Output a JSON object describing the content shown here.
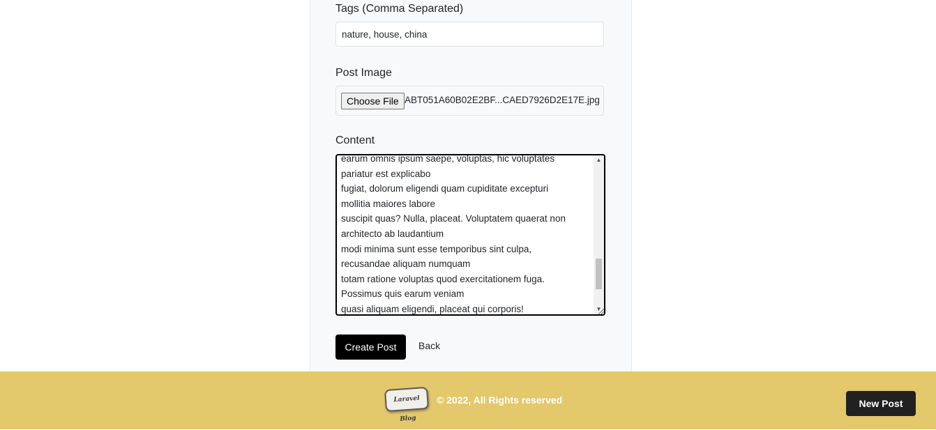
{
  "form": {
    "tags": {
      "label": "Tags (Comma Separated)",
      "value": "nature, house, china"
    },
    "image": {
      "label": "Post Image",
      "button_label": "Choose File",
      "file_name": "ABT051A60B02E2BF...CAED7926D2E17E.jpg"
    },
    "content": {
      "label": "Content",
      "value": "earum omnis ipsum saepe, voluptas, hic voluptates\npariatur est explicabo\nfugiat, dolorum eligendi quam cupiditate excepturi\nmollitia maiores labore\nsuscipit quas? Nulla, placeat. Voluptatem quaerat non\narchitecto ab laudantium\nmodi minima sunt esse temporibus sint culpa,\nrecusandae aliquam numquam\ntotam ratione voluptas quod exercitationem fuga.\nPossimus quis earum veniam\nquasi aliquam eligendi, placeat qui corporis!"
    },
    "submit_label": "Create Post",
    "back_label": "Back"
  },
  "footer": {
    "logo_text": "Laravel Blog",
    "copyright": "© 2022, All Rights reserved",
    "new_post_label": "New Post"
  }
}
